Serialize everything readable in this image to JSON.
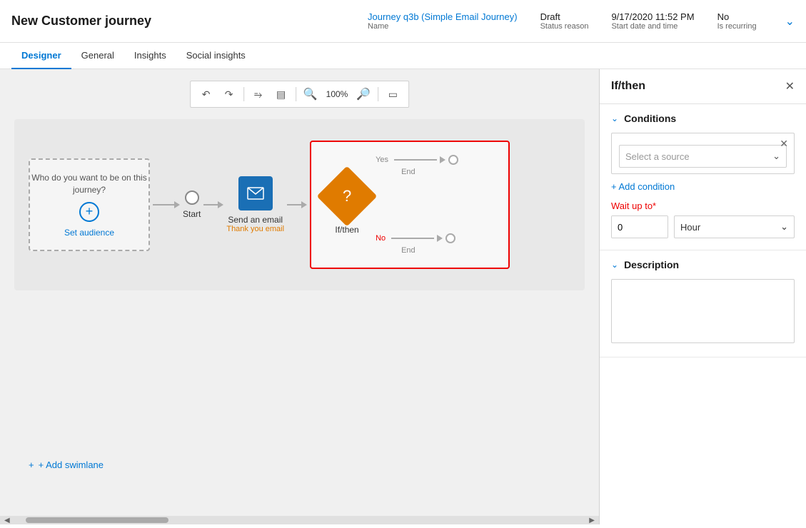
{
  "header": {
    "title": "New Customer journey",
    "journey_name": "Journey q3b (Simple Email Journey)",
    "journey_name_label": "Name",
    "status_reason": "Draft",
    "status_reason_label": "Status reason",
    "start_date": "9/17/2020 11:52 PM",
    "start_date_label": "Start date and time",
    "is_recurring": "No",
    "is_recurring_label": "Is recurring"
  },
  "nav_tabs": [
    "Designer",
    "General",
    "Insights",
    "Social insights"
  ],
  "active_tab": "Designer",
  "toolbar": {
    "undo": "↩",
    "redo": "↪",
    "fullscreen": "⤢",
    "grid": "⊞",
    "zoom_out": "−",
    "zoom_level": "100%",
    "zoom_in": "+",
    "fit": "⊡"
  },
  "canvas": {
    "set_audience_text": "Who do you want to be on this journey?",
    "set_audience_link": "Set audience",
    "start_label": "Start",
    "email_label": "Send an email",
    "email_sublabel": "Thank you email",
    "ifthen_label": "If/then",
    "yes_label": "Yes",
    "no_label": "No",
    "end_label1": "End",
    "end_label2": "End",
    "add_swimlane": "+ Add swimlane"
  },
  "right_panel": {
    "title": "If/then",
    "conditions_section": "Conditions",
    "select_source_placeholder": "Select a source",
    "add_condition": "+ Add condition",
    "wait_label": "Wait up to",
    "wait_value": "0",
    "wait_unit": "Hour",
    "description_section": "Description",
    "description_placeholder": ""
  }
}
